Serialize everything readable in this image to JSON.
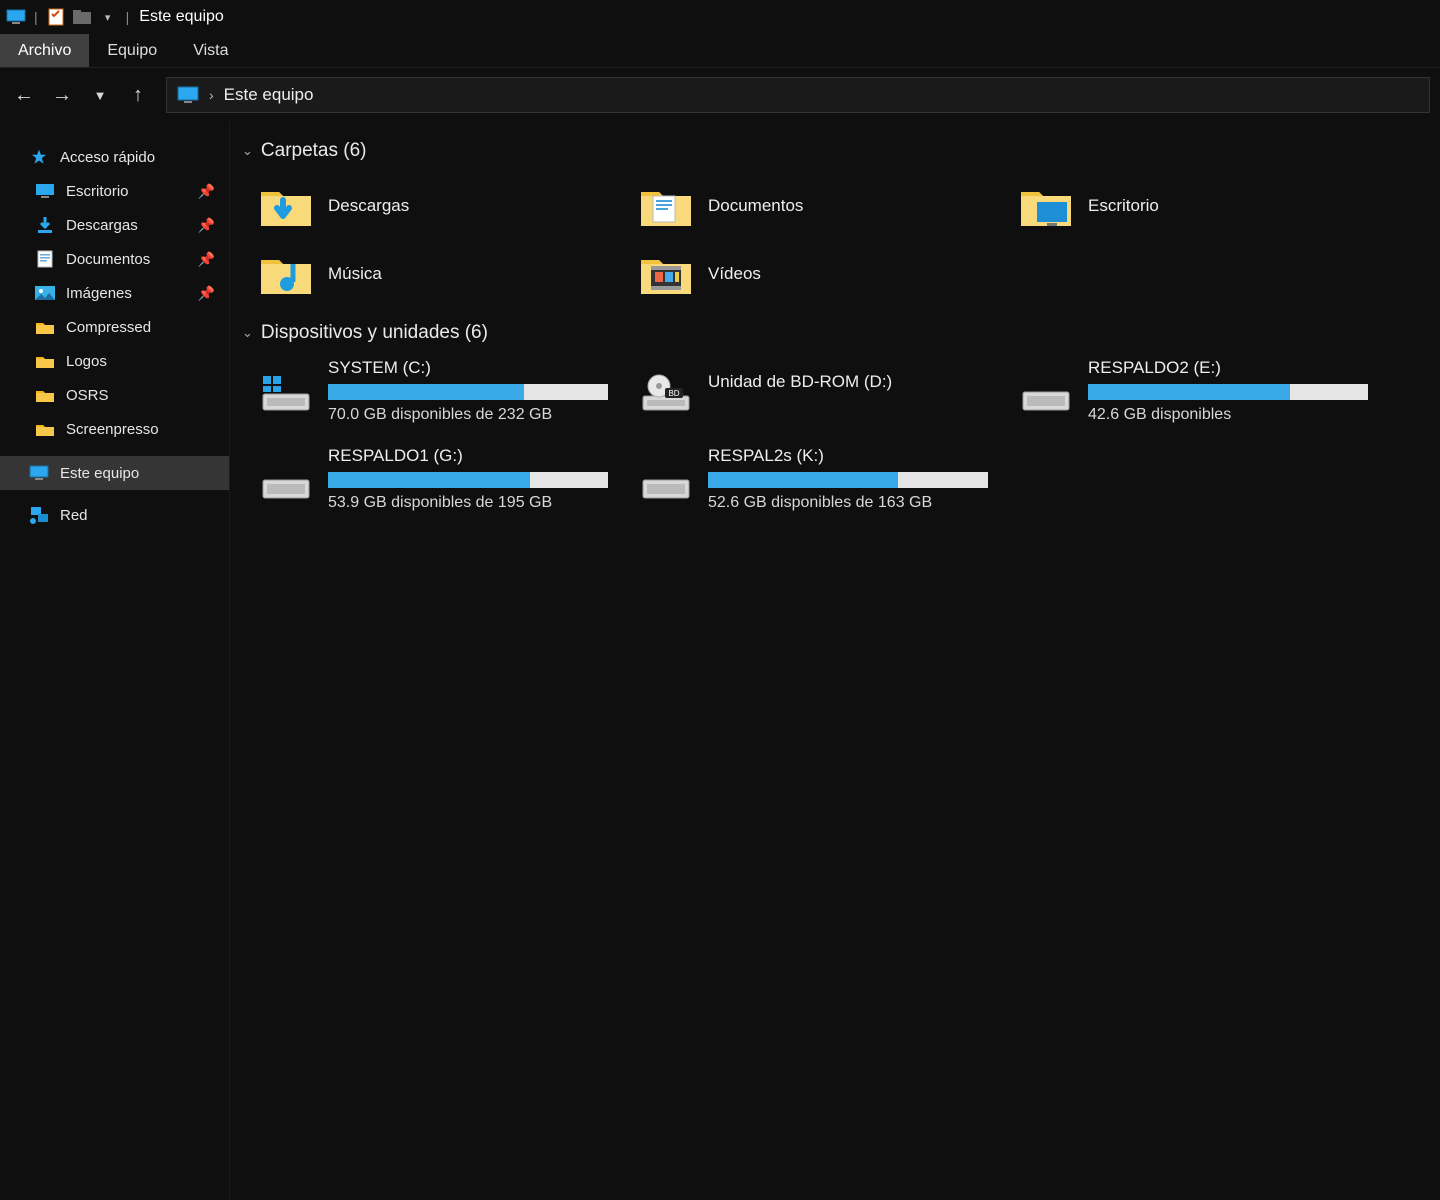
{
  "titlebar": {
    "title": "Este equipo"
  },
  "ribbon": {
    "tabs": [
      {
        "label": "Archivo",
        "active": true
      },
      {
        "label": "Equipo",
        "active": false
      },
      {
        "label": "Vista",
        "active": false
      }
    ]
  },
  "breadcrumb": {
    "root": "Este equipo"
  },
  "sidebar": {
    "quick_header": "Acceso rápido",
    "items": [
      {
        "label": "Escritorio",
        "icon": "desktop",
        "pinned": true
      },
      {
        "label": "Descargas",
        "icon": "download",
        "pinned": true
      },
      {
        "label": "Documentos",
        "icon": "document",
        "pinned": true
      },
      {
        "label": "Imágenes",
        "icon": "pictures",
        "pinned": true
      },
      {
        "label": "Compressed",
        "icon": "folder",
        "pinned": false
      },
      {
        "label": "Logos",
        "icon": "folder",
        "pinned": false
      },
      {
        "label": "OSRS",
        "icon": "folder",
        "pinned": false
      },
      {
        "label": "Screenpresso",
        "icon": "folder",
        "pinned": false
      }
    ],
    "this_pc": "Este equipo",
    "network": "Red"
  },
  "groups": {
    "folders_header": "Carpetas (6)",
    "drives_header": "Dispositivos y unidades (6)"
  },
  "folders": [
    {
      "label": "Descargas",
      "icon": "downloads"
    },
    {
      "label": "Documentos",
      "icon": "documents"
    },
    {
      "label": "Escritorio",
      "icon": "desktopf"
    },
    {
      "label": "Música",
      "icon": "music"
    },
    {
      "label": "Vídeos",
      "icon": "videos"
    }
  ],
  "drives": [
    {
      "name": "SYSTEM (C:)",
      "free_text": "70.0 GB disponibles de 232 GB",
      "fill_pct": 70,
      "kind": "system"
    },
    {
      "name": "Unidad de BD-ROM (D:)",
      "free_text": "",
      "fill_pct": null,
      "kind": "bd"
    },
    {
      "name": "RESPALDO2 (E:)",
      "free_text": "42.6 GB disponibles",
      "fill_pct": 72,
      "kind": "hdd"
    },
    {
      "name": "RESPALDO1 (G:)",
      "free_text": "53.9 GB disponibles de 195 GB",
      "fill_pct": 72,
      "kind": "hdd"
    },
    {
      "name": "RESPAL2s (K:)",
      "free_text": "52.6 GB disponibles de 163 GB",
      "fill_pct": 68,
      "kind": "hdd"
    }
  ]
}
